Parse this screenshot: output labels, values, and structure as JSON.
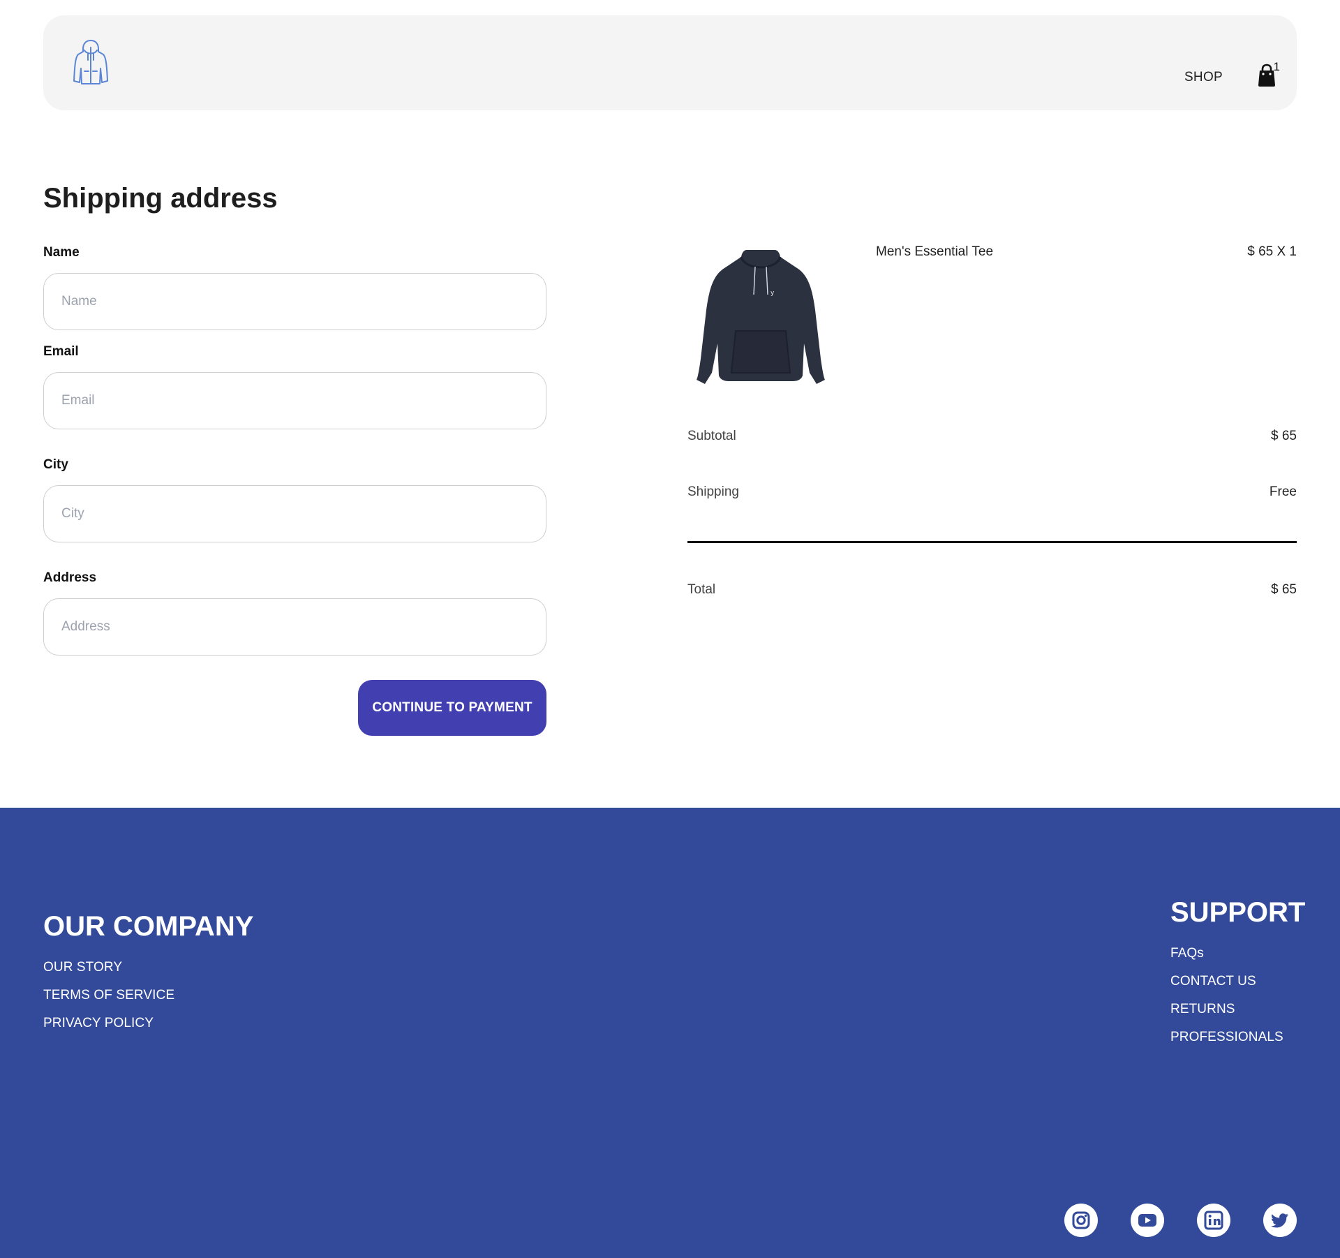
{
  "header": {
    "logo_icon": "hoodie-logo-icon",
    "nav": {
      "shop_label": "SHOP"
    },
    "cart": {
      "icon": "shopping-bag-icon",
      "count": "1"
    }
  },
  "form": {
    "title": "Shipping address",
    "fields": [
      {
        "label": "Name",
        "placeholder": "Name",
        "value": ""
      },
      {
        "label": "Email",
        "placeholder": "Email",
        "value": ""
      },
      {
        "label": "City",
        "placeholder": "City",
        "value": ""
      },
      {
        "label": "Address",
        "placeholder": "Address",
        "value": ""
      }
    ],
    "submit_label": "CONTINUE TO PAYMENT"
  },
  "order": {
    "items": [
      {
        "name": "Men's Essential Tee",
        "price": "$ 65 X 1",
        "image": "dark-hoodie-image"
      }
    ],
    "subtotal": {
      "label": "Subtotal",
      "value": "$ 65"
    },
    "shipping": {
      "label": "Shipping",
      "value": "Free"
    },
    "total": {
      "label": "Total",
      "value": "$ 65"
    }
  },
  "footer": {
    "company": {
      "heading": "OUR COMPANY",
      "links": [
        "OUR STORY",
        "TERMS OF SERVICE",
        "PRIVACY POLICY"
      ]
    },
    "support": {
      "heading": "SUPPORT",
      "links": [
        "FAQs",
        "CONTACT US",
        "RETURNS",
        "PROFESSIONALS"
      ]
    },
    "social": [
      "instagram-icon",
      "youtube-icon",
      "linkedin-icon",
      "twitter-icon"
    ]
  },
  "colors": {
    "header_bg": "#f4f4f4",
    "accent": "#4240b0",
    "footer_bg": "#334a9b",
    "logo_stroke": "#5b86d6"
  }
}
